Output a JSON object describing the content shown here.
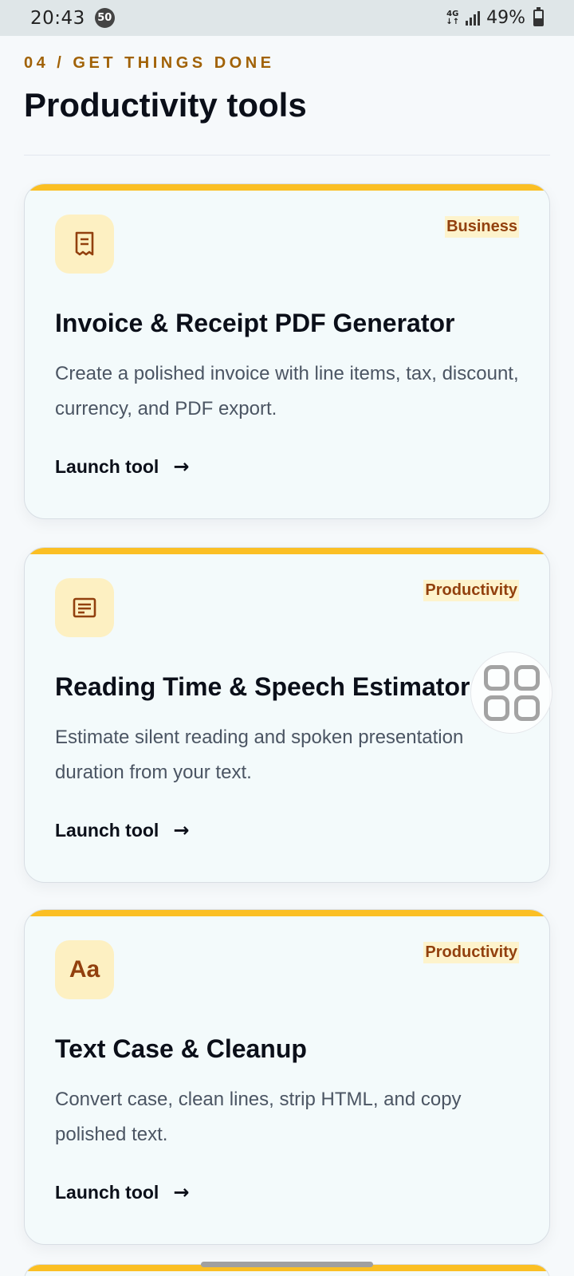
{
  "status_bar": {
    "time": "20:43",
    "notification_count": "50",
    "network": "4G",
    "battery": "49%",
    "battery_level": 0.49
  },
  "header": {
    "eyebrow": "04 / GET THINGS DONE",
    "title": "Productivity tools"
  },
  "cards": [
    {
      "icon": "receipt-icon",
      "badge": "Business",
      "title": "Invoice & Receipt PDF Generator",
      "description": "Create a polished invoice with line items, tax, discount, currency, and PDF export.",
      "launch_label": "Launch tool",
      "arrow": "→"
    },
    {
      "icon": "document-lines-icon",
      "badge": "Productivity",
      "title": "Reading Time & Speech Estimator",
      "description": "Estimate silent reading and spoken presentation duration from your text.",
      "launch_label": "Launch tool",
      "arrow": "→"
    },
    {
      "icon": "text-case-icon",
      "icon_text": "Aa",
      "badge": "Productivity",
      "title": "Text Case & Cleanup",
      "description": "Convert case, clean lines, strip HTML, and copy polished text.",
      "launch_label": "Launch tool",
      "arrow": "→"
    }
  ],
  "floating_button": {
    "icon": "apps-grid-icon"
  },
  "colors": {
    "accent": "#fbbf24",
    "eyebrow": "#a16207",
    "badge_text": "#92400e",
    "badge_bg": "#fdf3cc",
    "card_bg": "#f3fafb"
  }
}
